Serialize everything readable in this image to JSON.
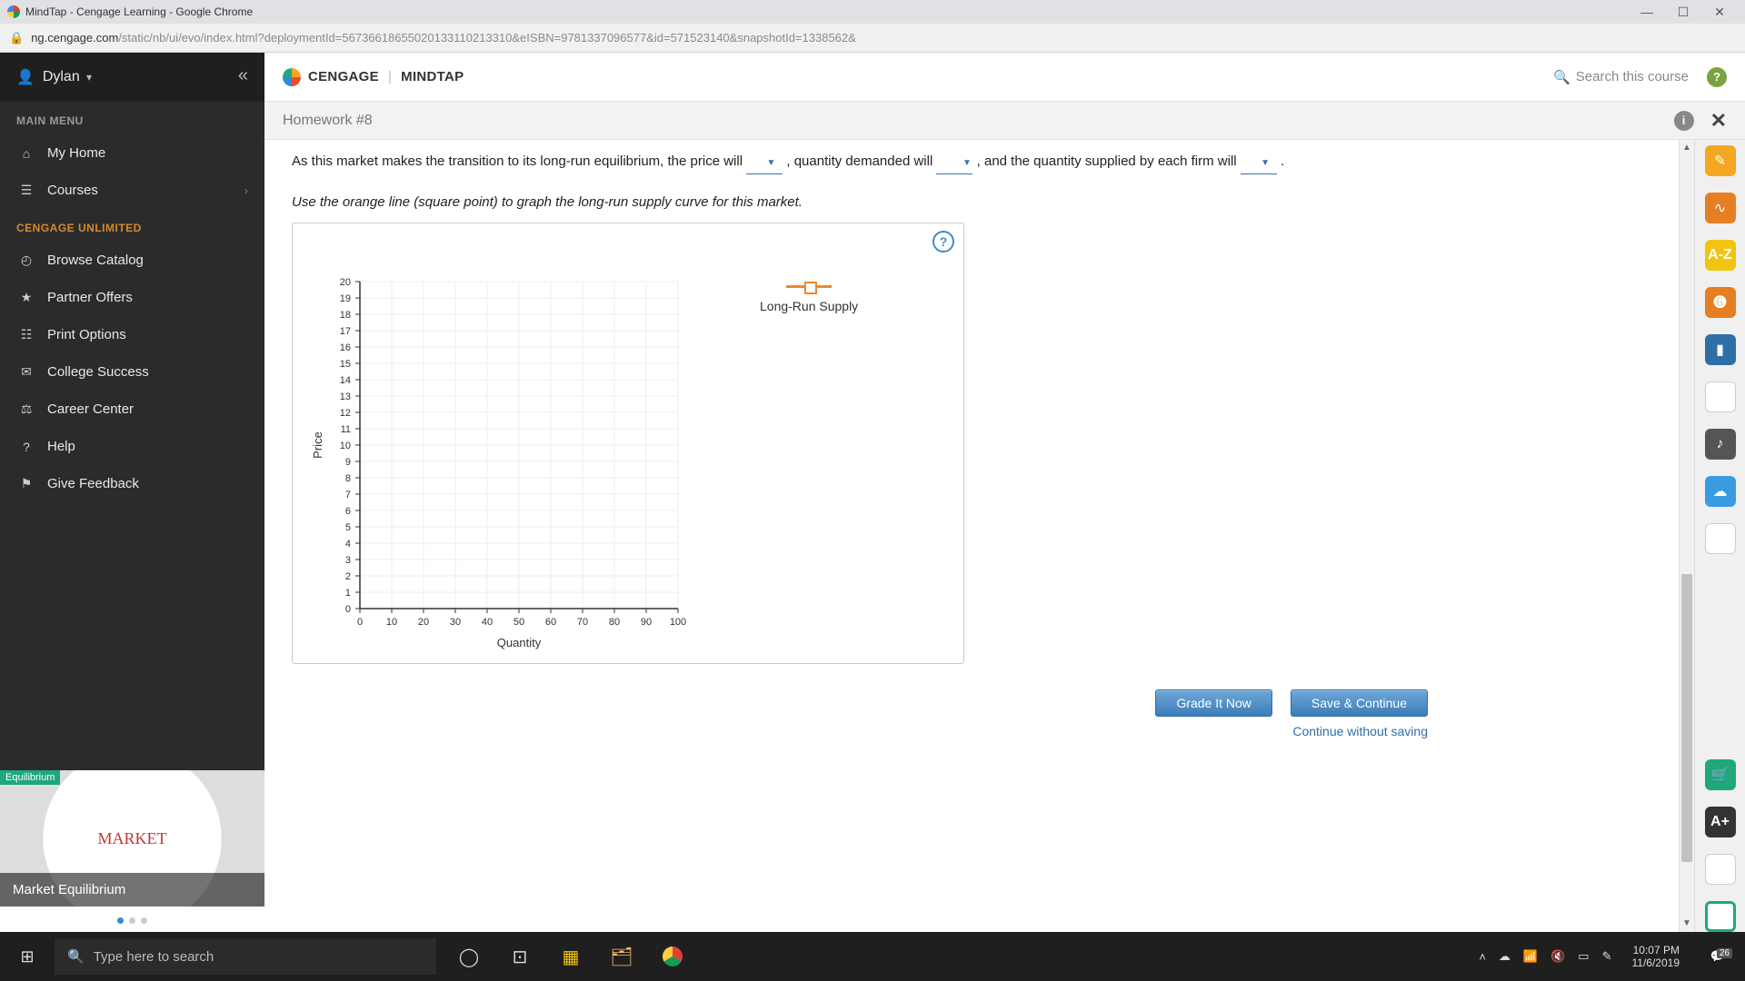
{
  "window": {
    "title": "MindTap - Cengage Learning - Google Chrome",
    "url_host": "ng.cengage.com",
    "url_path": "/static/nb/ui/evo/index.html?deploymentId=56736618655020133110213310&eISBN=9781337096577&id=571523140&snapshotId=1338562&"
  },
  "sidebar": {
    "user": "Dylan",
    "section_main": "MAIN MENU",
    "items_main": [
      {
        "icon": "⌂",
        "label": "My Home"
      },
      {
        "icon": "☰",
        "label": "Courses",
        "expandable": true
      }
    ],
    "section_unl": "CENGAGE UNLIMITED",
    "items_unl": [
      {
        "icon": "◴",
        "label": "Browse Catalog"
      },
      {
        "icon": "★",
        "label": "Partner Offers"
      },
      {
        "icon": "☷",
        "label": "Print Options"
      },
      {
        "icon": "✉",
        "label": "College Success"
      },
      {
        "icon": "⚖",
        "label": "Career Center"
      },
      {
        "icon": "?",
        "label": "Help"
      },
      {
        "icon": "⚑",
        "label": "Give Feedback"
      }
    ],
    "promo_tag": "Equilibrium",
    "promo_word": "MARKET",
    "promo_title": "Market Equilibrium"
  },
  "header": {
    "brand_a": "CENGAGE",
    "brand_b": "MINDTAP",
    "search_placeholder": "Search this course"
  },
  "crumb": {
    "title": "Homework #8"
  },
  "body": {
    "sentence_a": "As this market makes the transition to its long-run equilibrium, the price will ",
    "sentence_b": " , quantity demanded will ",
    "sentence_c": " , and the quantity supplied by each firm will ",
    "sentence_d": " .",
    "instruction": "Use the orange line (square point) to graph the long-run supply curve for this market.",
    "legend_label": "Long-Run Supply",
    "btn_grade": "Grade It Now",
    "btn_save": "Save & Continue",
    "link_skip": "Continue without saving"
  },
  "chart_data": {
    "type": "scatter",
    "title": "",
    "xlabel": "Quantity",
    "ylabel": "Price",
    "xlim": [
      0,
      100
    ],
    "ylim": [
      0,
      20
    ],
    "xticks": [
      0,
      10,
      20,
      30,
      40,
      50,
      60,
      70,
      80,
      90,
      100
    ],
    "yticks": [
      0,
      1,
      2,
      3,
      4,
      5,
      6,
      7,
      8,
      9,
      10,
      11,
      12,
      13,
      14,
      15,
      16,
      17,
      18,
      19,
      20
    ],
    "series": [
      {
        "name": "Long-Run Supply",
        "color": "#e98a2b",
        "marker": "square",
        "x": [],
        "y": []
      }
    ]
  },
  "taskbar": {
    "search_placeholder": "Type here to search",
    "time": "10:07 PM",
    "date": "11/6/2019",
    "notif_count": "26"
  }
}
